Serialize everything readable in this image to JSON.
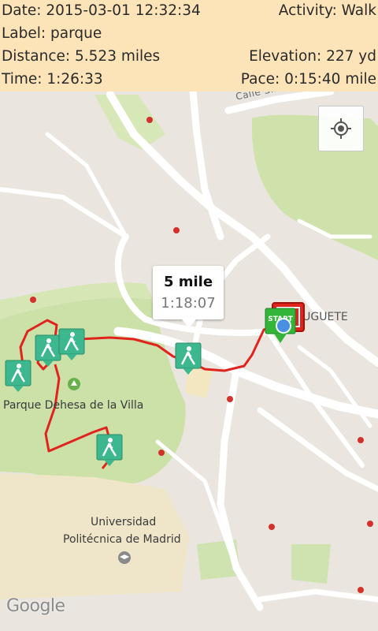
{
  "header": {
    "date": "Date: 2015-03-01 12:32:34",
    "activity": "Activity: Walk",
    "label": "Label: parque",
    "distance": "Distance: 5.523 miles",
    "elevation": "Elevation: 227 yd",
    "time": "Time: 1:26:33",
    "pace": "Pace: 0:15:40 mile"
  },
  "map": {
    "street_sinesio": "Calle Sinesio Delg",
    "place_juguete": "JUGUETE",
    "park_label": "Parque Dehesa de la Villa",
    "university_line1": "Universidad",
    "university_line2": "Politécnica de Madrid",
    "google_logo": "Google",
    "start_marker_text": "START",
    "route_color": "#e0231d",
    "walker_marker_color": "#3db88e",
    "start_marker_color": "#33b53a"
  },
  "callout": {
    "title": "5 mile",
    "time": "1:18:07"
  },
  "controls": {
    "my_location": "my-location-icon"
  }
}
